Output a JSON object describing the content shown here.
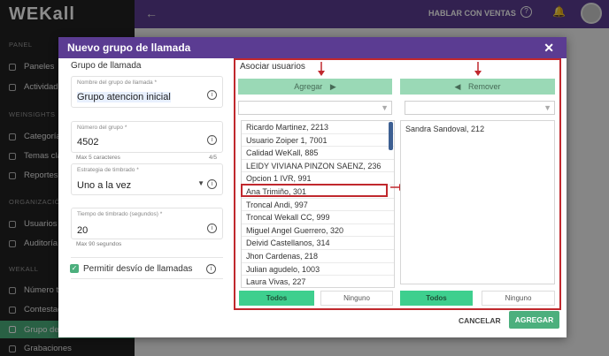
{
  "app": {
    "logo": "WEKall",
    "header_link": "HABLAR CON VENTAS"
  },
  "sidebar": {
    "sections": [
      "PANEL",
      "WEINSIGHTS",
      "ORGANIZACIÓN",
      "WEKALL"
    ],
    "items": [
      {
        "label": "Paneles"
      },
      {
        "label": "Actividad E"
      },
      {
        "label": "Categorías"
      },
      {
        "label": "Temas clav"
      },
      {
        "label": "Reportes A"
      },
      {
        "label": "Usuarios"
      },
      {
        "label": "Auditoría d"
      },
      {
        "label": "Número tel"
      },
      {
        "label": "Contestado"
      },
      {
        "label": "Grupo de ll"
      },
      {
        "label": "Grabaciones"
      }
    ]
  },
  "modal": {
    "title": "Nuevo grupo de llamada",
    "left_title": "Grupo de llamada",
    "fields": {
      "nombre": {
        "label": "Nombre del grupo de llamada *",
        "value": "Grupo atencion inicial"
      },
      "numero": {
        "label": "Número del grupo *",
        "value": "4502",
        "hint": "Max 5 caracteres",
        "count": "4/5"
      },
      "estrategia": {
        "label": "Estrategia de timbrado *",
        "value": "Uno a la vez"
      },
      "tiempo": {
        "label": "Tiempo de timbrado (segundos) *",
        "value": "20",
        "hint": "Max 90 segundos"
      }
    },
    "checkbox_label": "Permitir desvío de llamadas",
    "assoc": {
      "title": "Asociar usuarios",
      "add_label": "Agregar",
      "remove_label": "Remover",
      "available": [
        "Ricardo Martinez, 2213",
        "Usuario Zoiper 1, 7001",
        "Calidad WeKall, 885",
        "LEIDY VIVIANA PINZON SAENZ, 236",
        "Opcion 1 IVR, 991",
        "Ana Trimiño, 301",
        "Troncal Andi, 997",
        "Troncal Wekall CC, 999",
        "Miguel Angel Guerrero, 320",
        "Deivid Castellanos, 314",
        "Jhon Cardenas, 218",
        "Julian agudelo, 1003",
        "Laura Vivas, 227"
      ],
      "selected": [
        "Sandra Sandoval, 212"
      ],
      "todos_label": "Todos",
      "ninguno_label": "Ninguno"
    },
    "cancel_label": "CANCELAR",
    "submit_label": "AGREGAR"
  }
}
